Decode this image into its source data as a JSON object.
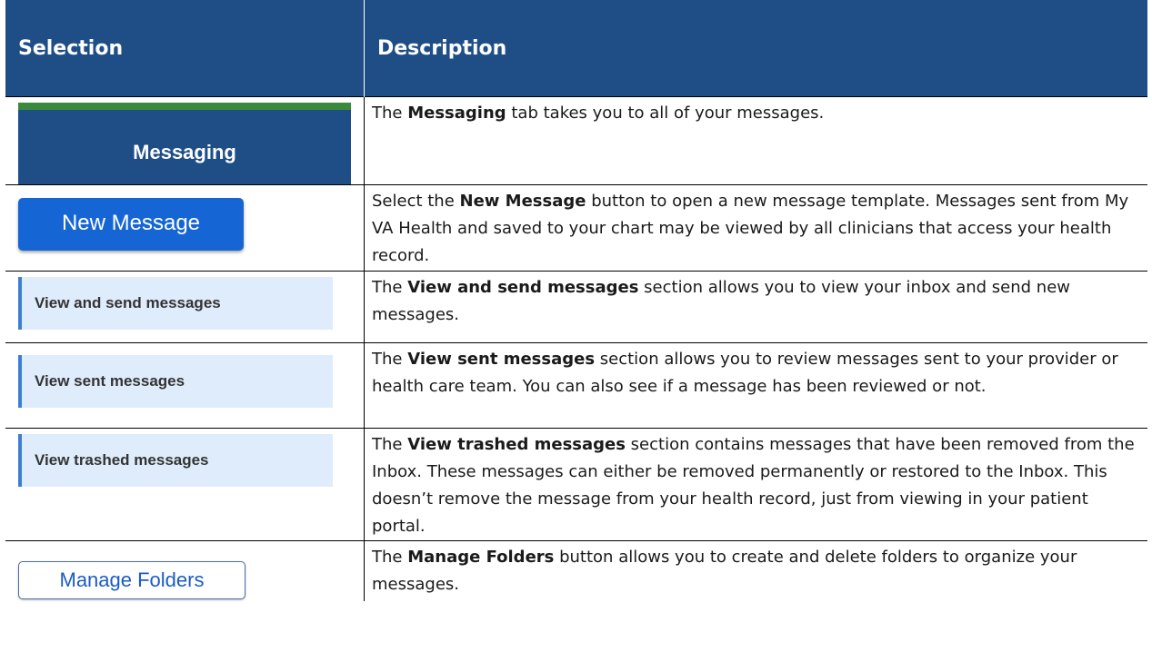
{
  "table": {
    "header": {
      "selection": "Selection",
      "description": "Description"
    },
    "rows": [
      {
        "selection_label": "Messaging",
        "desc": [
          {
            "t": "The "
          },
          {
            "b": "Messaging"
          },
          {
            "t": " tab takes you to all of your messages."
          }
        ]
      },
      {
        "selection_label": "New Message",
        "desc": [
          {
            "t": "Select the "
          },
          {
            "b": "New Message"
          },
          {
            "t": " button to open a new message template. Messages sent from My VA Health and saved to your chart may be viewed by all clinicians that access your health record."
          }
        ]
      },
      {
        "selection_label": "View and send messages",
        "desc": [
          {
            "t": "The "
          },
          {
            "b": "View and send messages"
          },
          {
            "t": " section allows you to view your inbox and send new messages."
          }
        ]
      },
      {
        "selection_label": "View sent messages",
        "desc": [
          {
            "t": "The "
          },
          {
            "b": "View sent messages"
          },
          {
            "t": " section allows you to review messages sent to your provider or health care team. You can also see if a message has been reviewed or not."
          }
        ]
      },
      {
        "selection_label": "View trashed messages",
        "desc": [
          {
            "t": "The "
          },
          {
            "b": "View trashed messages"
          },
          {
            "t": " section contains messages that have been removed from the Inbox. These messages can either be removed permanently or restored to the Inbox. This doesn’t remove the message from your health record, just from viewing in your patient portal."
          }
        ]
      },
      {
        "selection_label": "Manage Folders",
        "desc": [
          {
            "t": "The "
          },
          {
            "b": "Manage Folders"
          },
          {
            "t": " button allows you to create and delete folders to organize your messages."
          }
        ]
      }
    ]
  },
  "colors": {
    "header_bg": "#1f4e86",
    "tab_accent": "#3a8a3e",
    "primary_button": "#1566d4",
    "nav_bg": "#dfecfb",
    "nav_border": "#3b7fd4"
  }
}
